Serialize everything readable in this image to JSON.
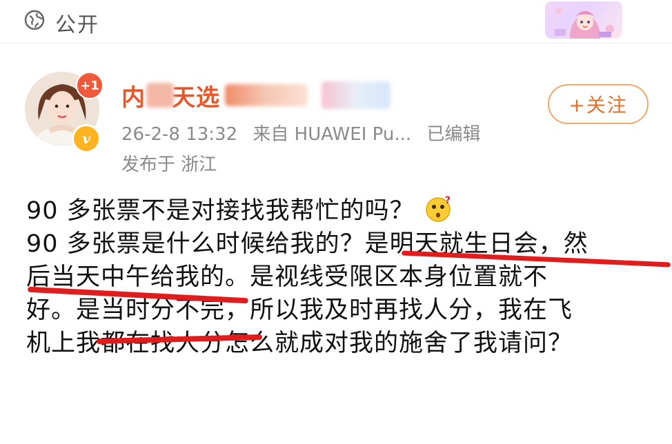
{
  "header": {
    "visibility_label": "公开",
    "icon": "globe-icon",
    "sticker": "anime-girl-sticker"
  },
  "author": {
    "name_visible": "内",
    "name_visible_2": "天选",
    "notification_badge": "+1",
    "verified_mark": "v",
    "follow_label": "+关注"
  },
  "meta": {
    "date": "26-2-8 13:32",
    "source": "来自 HUAWEI Pu...",
    "edited": "已编辑",
    "location": "发布于 浙江"
  },
  "post": {
    "line1": "90 多张票不是对接找我帮忙的吗？",
    "line2": "90 多张票是什么时候给我的？是明天就生日会，然",
    "line3": "后当天中午给我的。是视线受限区本身位置就不",
    "line4": "好。是当时分不完，所以我及时再找人分，我在飞",
    "line5": "机上我都在找人分怎么就成对我的施舍了我请问？"
  },
  "colors": {
    "name": "#e8572a",
    "follow": "#e8702a",
    "meta": "#8a8a8a",
    "underline": "#e01c1c",
    "badge": "#f05a3a",
    "verified": "#ffb321"
  }
}
